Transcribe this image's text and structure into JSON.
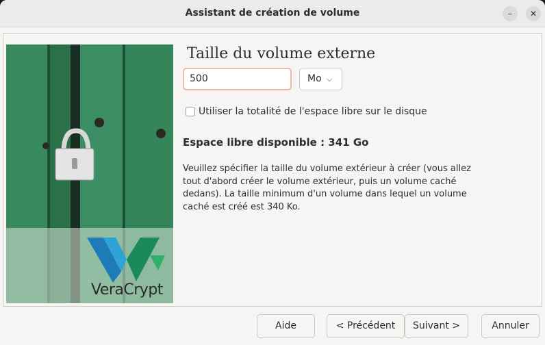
{
  "window": {
    "title": "Assistant de création de volume",
    "minimize_glyph": "–",
    "close_glyph": "✕"
  },
  "banner": {
    "brand": "VeraCrypt",
    "logo_icon": "veracrypt-logo-icon",
    "image_icon": "padlock-icon"
  },
  "main": {
    "heading": "Taille du volume externe",
    "size_value": "500",
    "unit": "Mo",
    "unit_chevron": "⌵",
    "checkbox_label": "Utiliser la totalité de l'espace libre sur le disque",
    "checkbox_checked": false,
    "free_space": "Espace libre disponible : 341 Go",
    "description_lines": [
      "Veuillez spécifier la taille du volume extérieur à créer (vous allez",
      "tout d'abord créer le volume extérieur, puis un volume caché",
      "dedans). La taille minimum d'un volume dans lequel un volume",
      "caché est créé est 340 Ko."
    ]
  },
  "buttons": {
    "help": "Aide",
    "previous": "< Précédent",
    "next": "Suivant >",
    "cancel": "Annuler"
  }
}
